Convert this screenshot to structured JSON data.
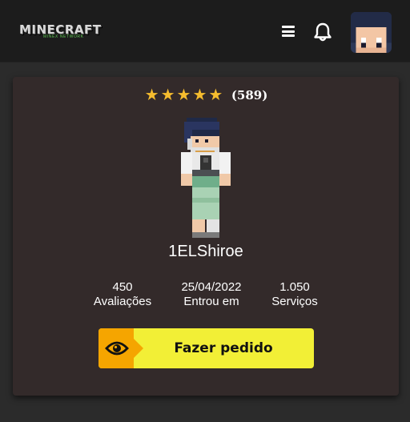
{
  "header": {
    "logo_text": "MINECRAFT",
    "logo_subtext": "MINEX NETWORK",
    "menu_icon": "hamburger-menu-icon",
    "notification_icon": "bell-icon",
    "avatar_icon": "minecraft-face-avatar"
  },
  "profile": {
    "rating_stars": 5,
    "rating_count": "(589)",
    "username": "1ELShiroe",
    "stats": [
      {
        "value": "450",
        "label": "Avaliações"
      },
      {
        "value": "25/04/2022",
        "label": "Entrou em"
      },
      {
        "value": "1.050",
        "label": "Serviços"
      }
    ]
  },
  "action": {
    "button_label": "Fazer pedido",
    "button_icon": "eye-icon"
  },
  "colors": {
    "accent_yellow": "#f2ef36",
    "accent_orange": "#f5a500",
    "star": "#f5bc2e",
    "card_bg": "#332a2a"
  }
}
